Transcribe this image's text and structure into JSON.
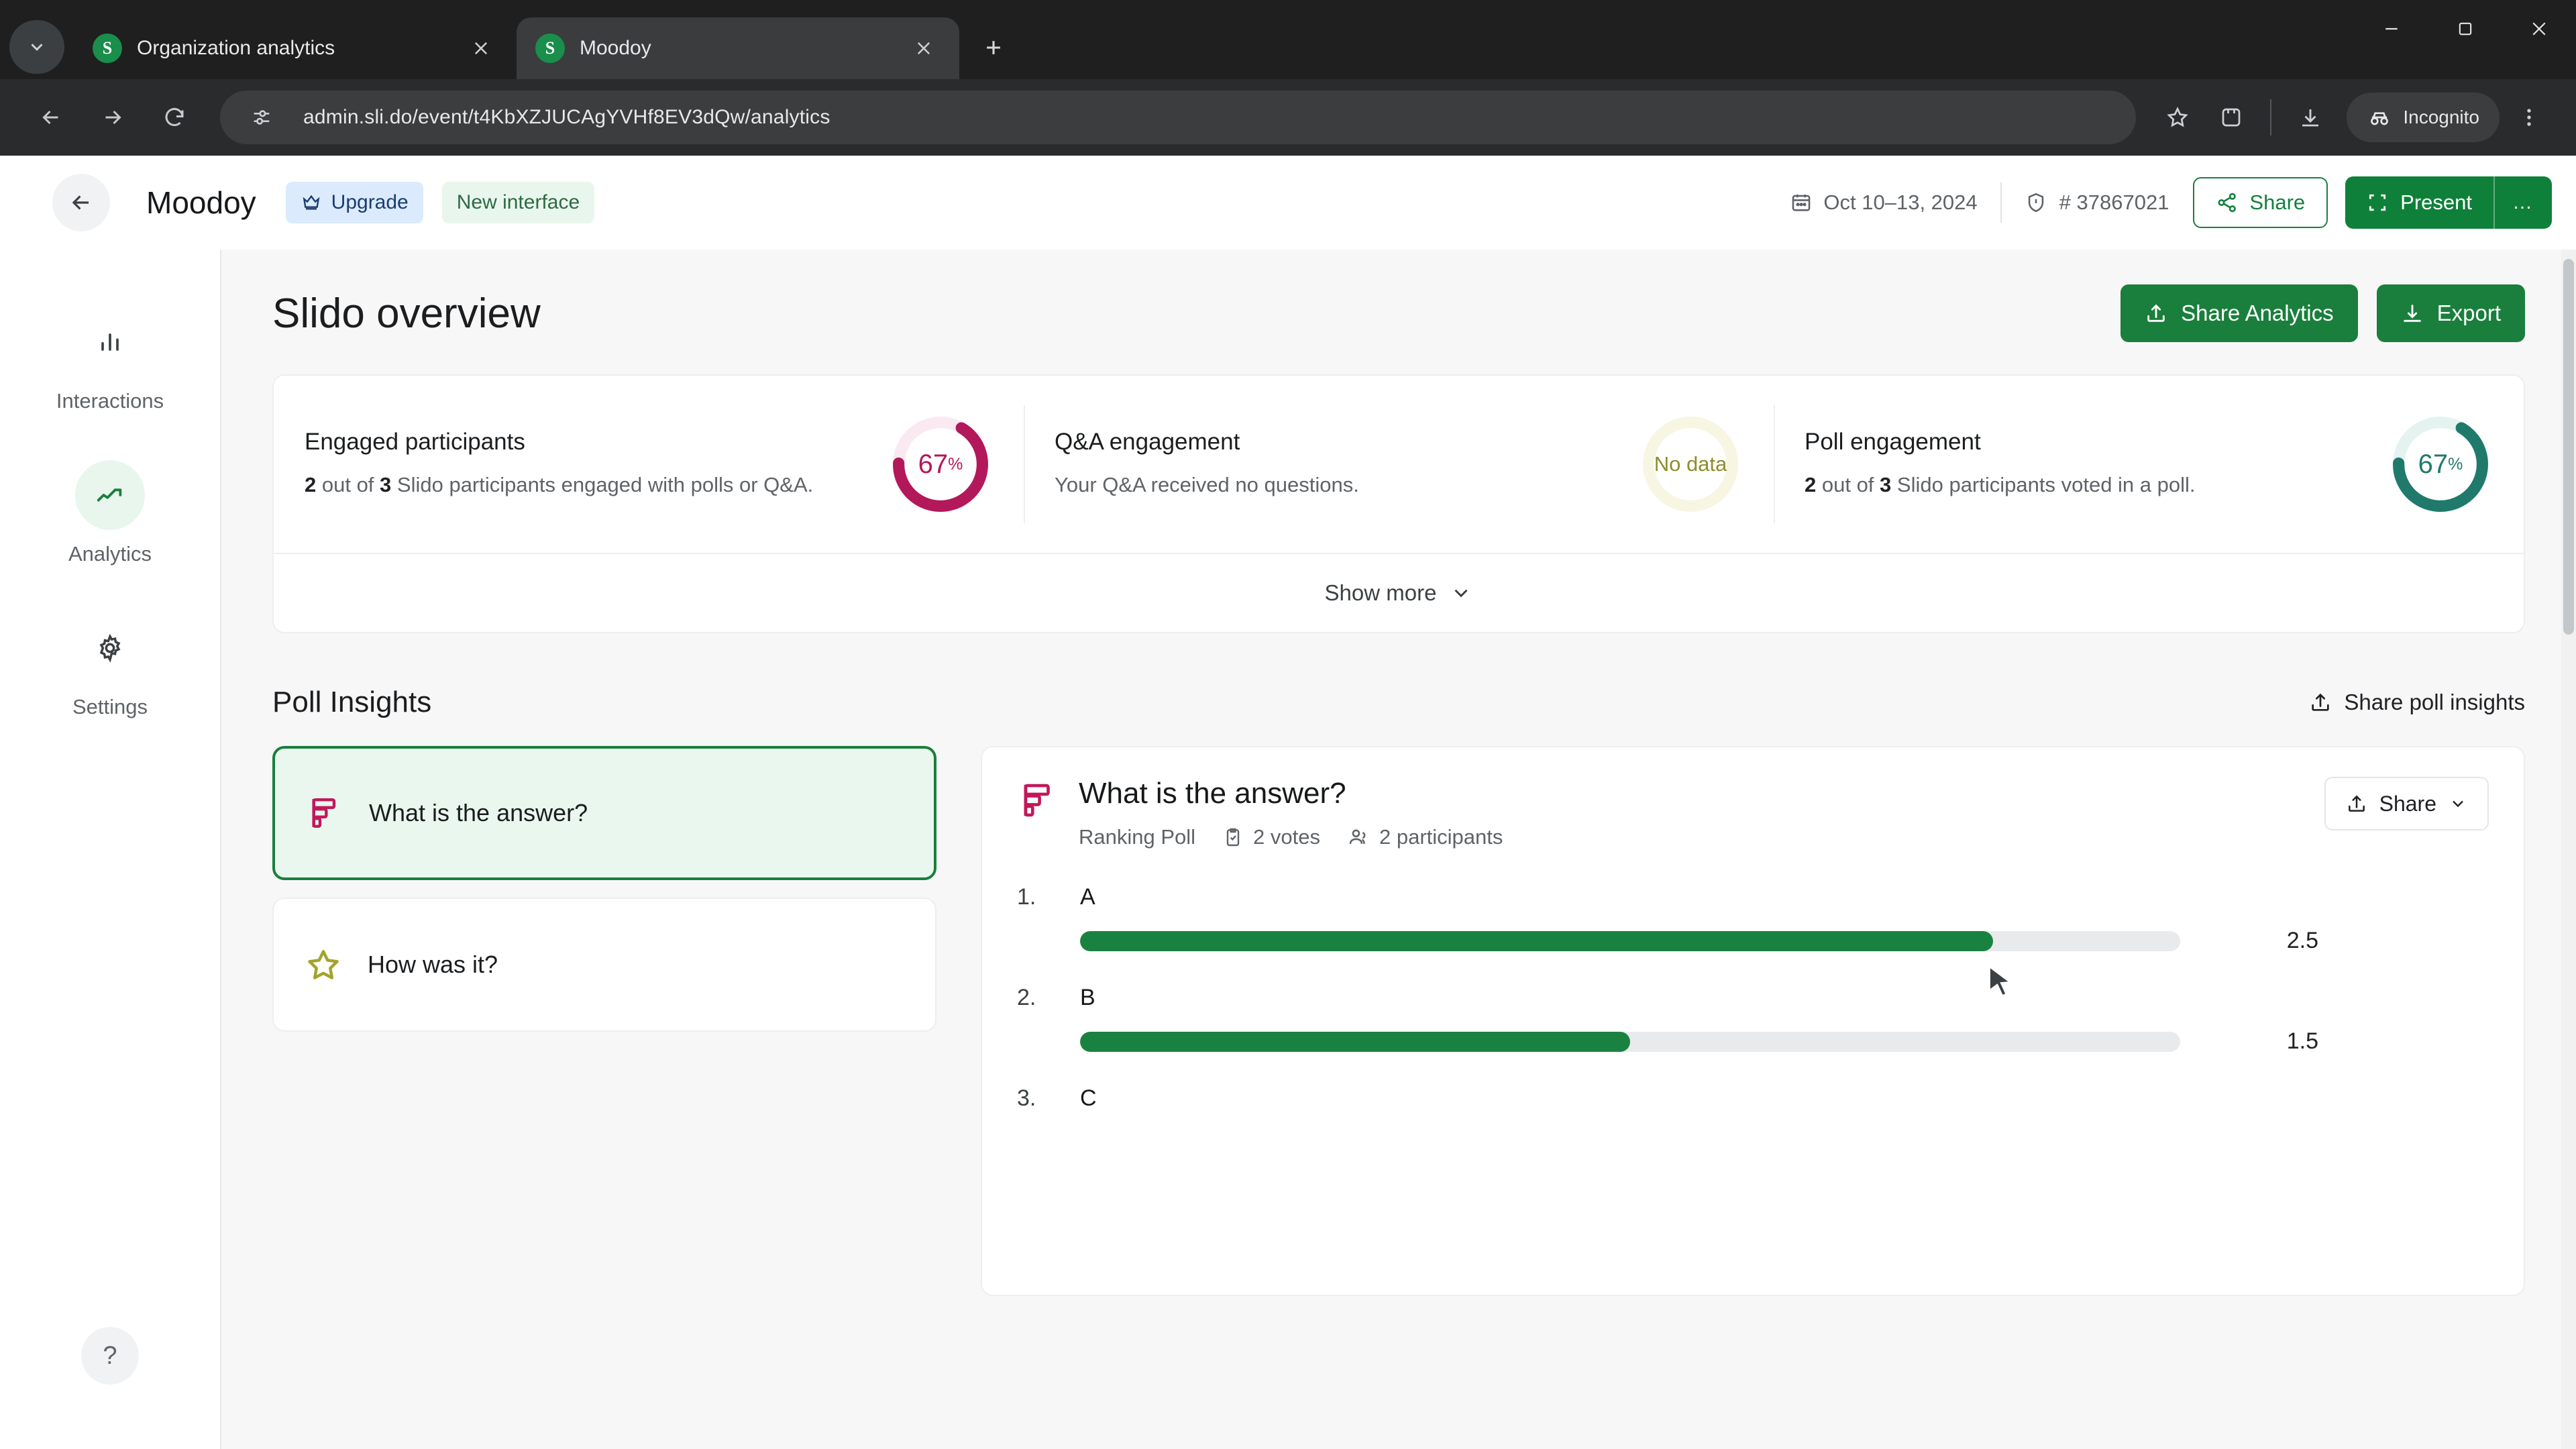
{
  "browser": {
    "tabs": [
      {
        "title": "Organization analytics",
        "active": false,
        "favicon_letter": "S"
      },
      {
        "title": "Moodoy",
        "active": true,
        "favicon_letter": "S"
      }
    ],
    "new_tab_label": "+",
    "url": "admin.sli.do/event/t4KbXZJUCAgYVHf8EV3dQw/analytics",
    "incognito_label": "Incognito",
    "window_controls": {
      "minimize": "–",
      "maximize": "❐",
      "close": "✕"
    }
  },
  "app_header": {
    "event_title": "Moodoy",
    "upgrade_label": "Upgrade",
    "new_interface_label": "New interface",
    "date_range": "Oct 10–13, 2024",
    "event_code": "# 37867021",
    "share_label": "Share",
    "present_label": "Present",
    "more_label": "…"
  },
  "sidebar": {
    "items": [
      {
        "label": "Interactions",
        "icon": "bar-chart-icon",
        "active": false
      },
      {
        "label": "Analytics",
        "icon": "trend-up-icon",
        "active": true
      },
      {
        "label": "Settings",
        "icon": "gear-icon",
        "active": false
      }
    ],
    "help_label": "?"
  },
  "overview": {
    "title": "Slido overview",
    "share_analytics_label": "Share Analytics",
    "export_label": "Export",
    "show_more_label": "Show more",
    "stats": [
      {
        "title": "Engaged participants",
        "desc_prefix": "",
        "desc_bold_1": "2",
        "desc_mid_1": " out of ",
        "desc_bold_2": "3",
        "desc_tail": " Slido participants engaged with polls or Q&A.",
        "value": "67",
        "unit": "%",
        "percent": 67,
        "color": "#b3185a",
        "track": "#fae9f0",
        "has_data": true
      },
      {
        "title": "Q&A engagement",
        "desc_tail": "Your Q&A received no questions.",
        "value": "No data",
        "unit": "",
        "percent": 0,
        "color": "#9a9a2e",
        "track": "#f6f6e2",
        "has_data": false
      },
      {
        "title": "Poll engagement",
        "desc_bold_1": "2",
        "desc_mid_1": " out of ",
        "desc_bold_2": "3",
        "desc_tail": " Slido participants voted in a poll.",
        "value": "67",
        "unit": "%",
        "percent": 67,
        "color": "#1f7a6b",
        "track": "#e4f3f0",
        "has_data": true
      }
    ]
  },
  "poll_insights": {
    "section_title": "Poll Insights",
    "share_label": "Share poll insights",
    "polls": [
      {
        "label": "What is the answer?",
        "icon": "ranking-poll-icon",
        "selected": true
      },
      {
        "label": "How was it?",
        "icon": "star-rating-icon",
        "selected": false
      }
    ],
    "detail": {
      "question": "What is the answer?",
      "type": "Ranking Poll",
      "votes": "2 votes",
      "participants": "2 participants",
      "share_label": "Share",
      "results": [
        {
          "rank": "1.",
          "option": "A",
          "value": "2.5",
          "pct": 83
        },
        {
          "rank": "2.",
          "option": "B",
          "value": "1.5",
          "pct": 50
        },
        {
          "rank": "3.",
          "option": "C",
          "value": "",
          "pct": 0
        }
      ]
    }
  },
  "chart_data": {
    "type": "bar",
    "title": "What is the answer?",
    "subtitle": "Ranking Poll — 2 votes, 2 participants",
    "orientation": "horizontal",
    "categories": [
      "A",
      "B",
      "C"
    ],
    "values": [
      2.5,
      1.5,
      null
    ],
    "ranks": [
      1,
      2,
      3
    ],
    "xlabel": "",
    "ylabel": "",
    "xlim": [
      0,
      3
    ],
    "grid": false,
    "legend": "none",
    "bar_color": "#1a8240",
    "track_color": "#e8eaeb"
  }
}
